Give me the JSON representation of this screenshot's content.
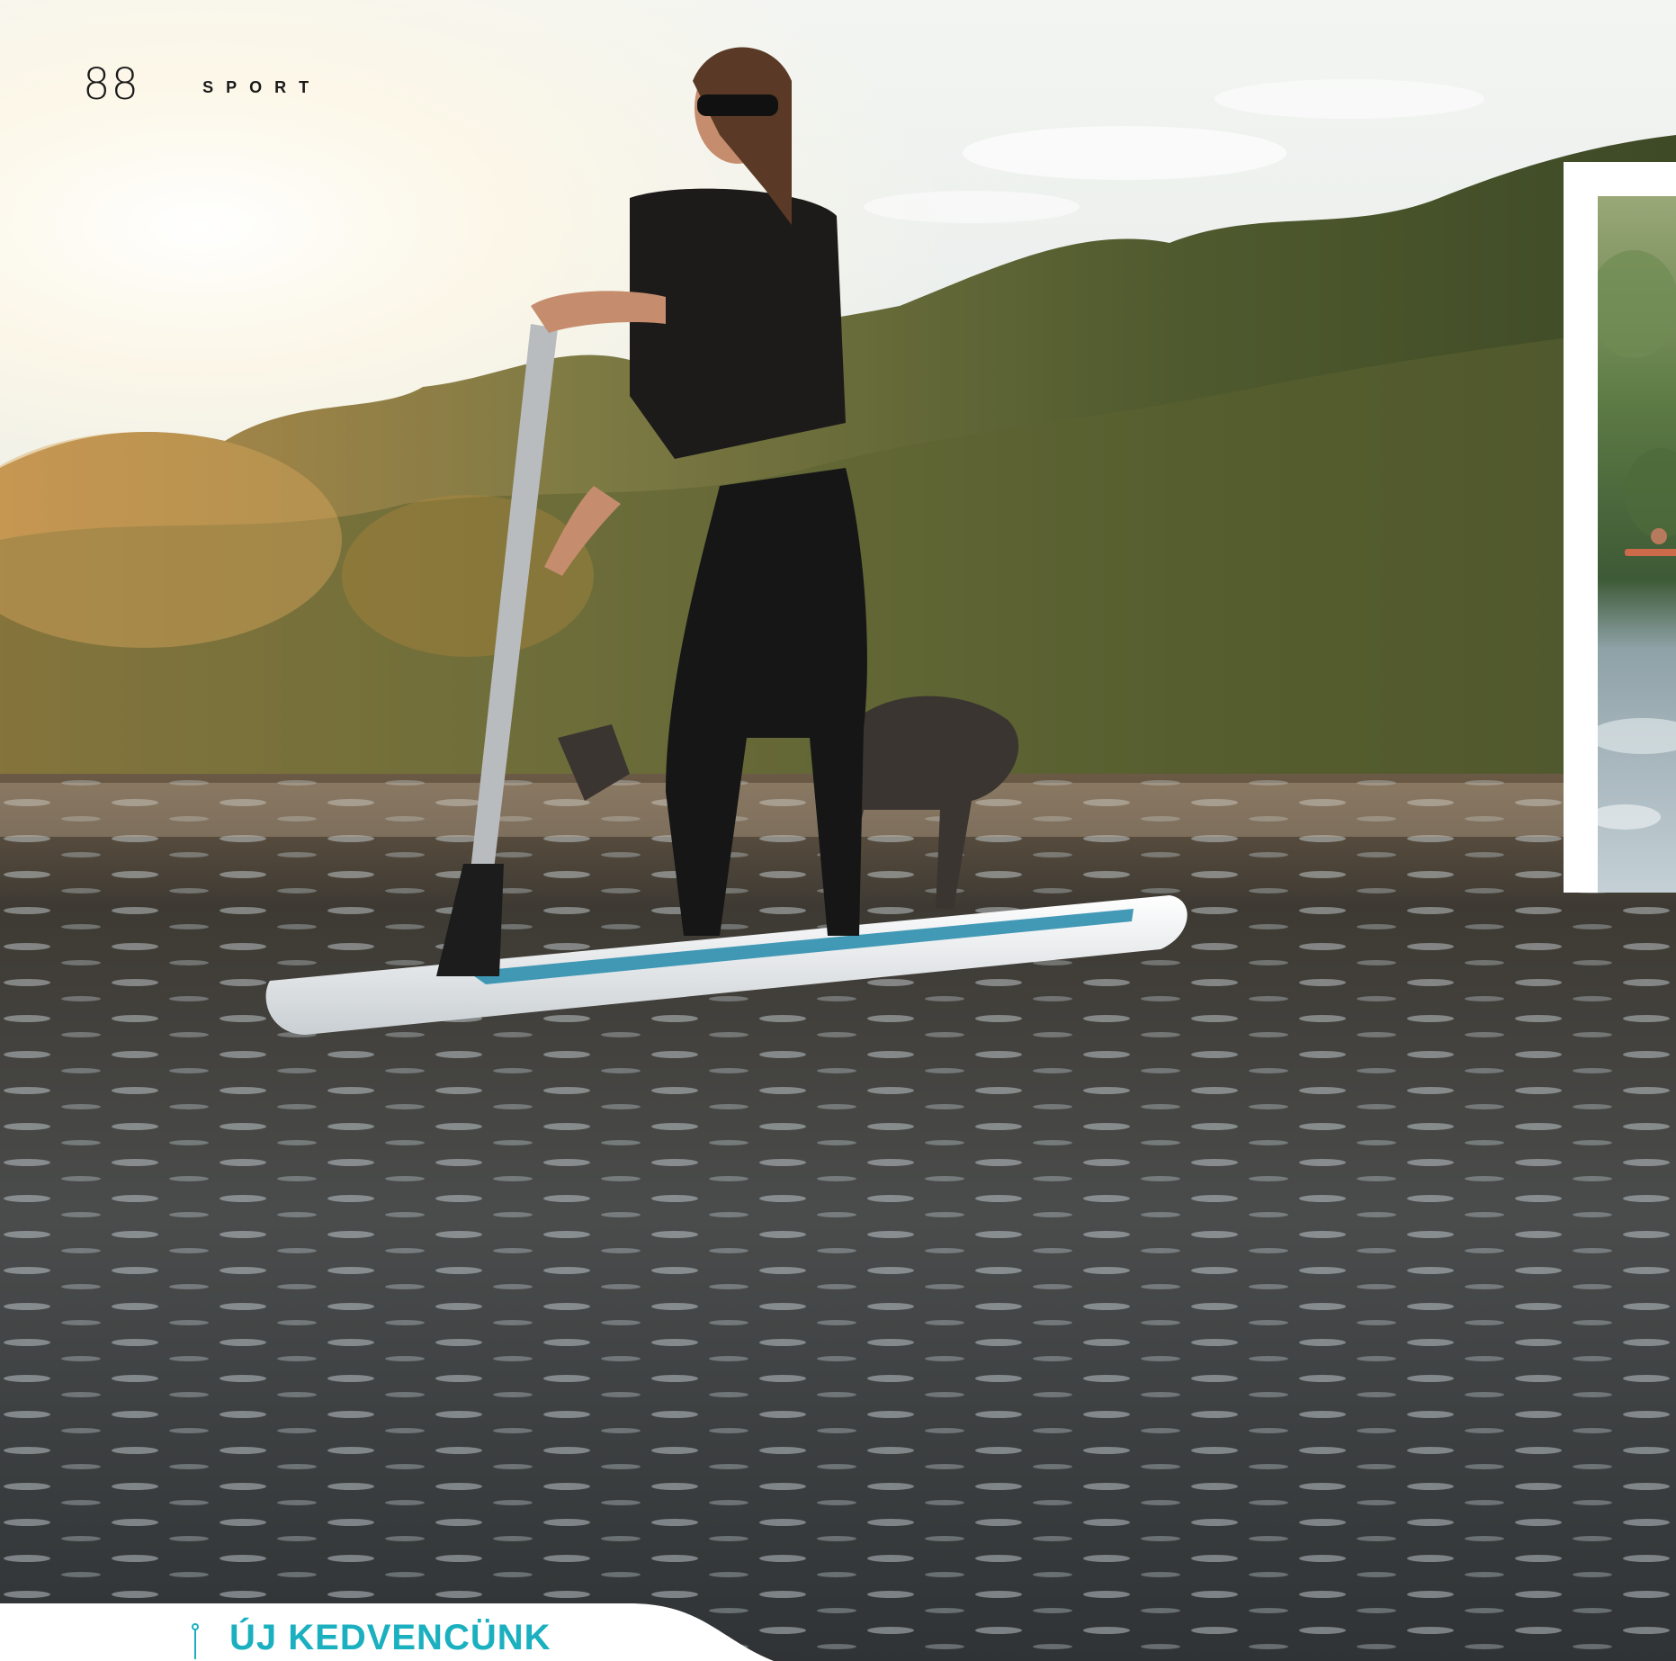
{
  "header": {
    "page_number": "88",
    "section": "SPORT"
  },
  "photo": {
    "subject": "woman-on-paddleboard-with-dog"
  },
  "inset_photo": {
    "subject": "river-paddling"
  },
  "footer_tab": {
    "label": "ÚJ KEDVENCÜNK",
    "accent_color": "#1ab0bf"
  }
}
